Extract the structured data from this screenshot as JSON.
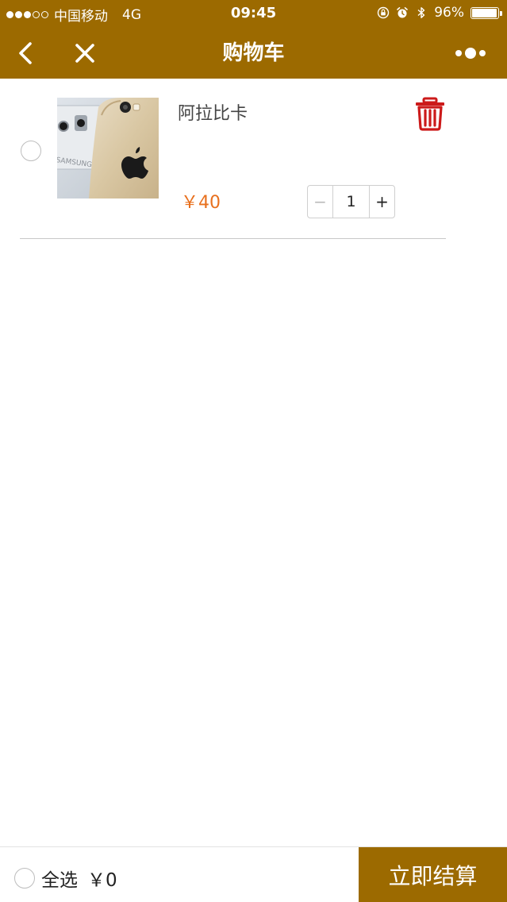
{
  "status_bar": {
    "carrier": "中国移动",
    "network": "4G",
    "time": "09:45",
    "battery_text": "96%",
    "battery_level": 0.96,
    "signal_dots_filled": 3,
    "signal_dots_total": 5
  },
  "nav": {
    "title": "购物车",
    "back_icon": "chevron-left-icon",
    "close_icon": "close-icon",
    "more_icon": "more-dots-icon"
  },
  "cart": {
    "items": [
      {
        "name": "阿拉比卡",
        "price": "￥40",
        "quantity": "1",
        "minus_label": "−",
        "plus_label": "+",
        "selected": false
      }
    ]
  },
  "footer": {
    "select_all_label": "全选",
    "total": "￥0",
    "checkout_label": "立即结算"
  },
  "colors": {
    "brand": "#9c6a00",
    "price": "#e8701e",
    "delete": "#cc1a1a",
    "background": "#ffffff"
  }
}
